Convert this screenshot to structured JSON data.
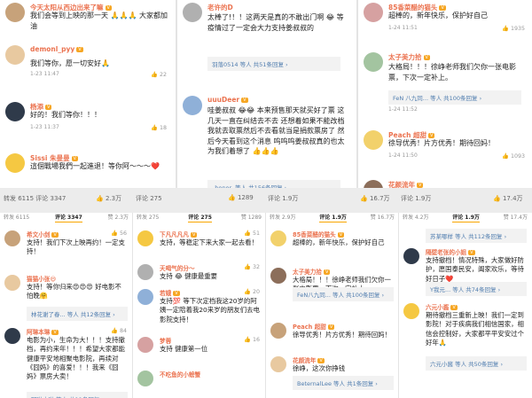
{
  "top": [
    [
      {
        "name": "今天太阳从西边出来了嘛",
        "lvl": "V",
        "text": "我们会等到上映的那一天 🙏🙏🙏 大家都加油",
        "meta": "",
        "like": ""
      },
      {
        "name": "demonl_pyy",
        "lvl": "V",
        "text": "我们等你，愿一切安好🙏",
        "meta": "1-23 11:47",
        "like": "👍 22"
      },
      {
        "name": "杨添",
        "lvl": "V",
        "text": "好的！我们等你！！！",
        "meta": "1-23 11:37",
        "like": "👍 18"
      },
      {
        "name": "Sissi 朱曼曼",
        "lvl": "V",
        "text": "這個戰場我們一起進退！等你阿～～～❤️",
        "meta": "",
        "like": ""
      }
    ],
    [
      {
        "name": "老许的D",
        "lvl": "",
        "text": "太棒了!！！这两天是真的不敢出门啊 😂 等疫情过了一定会大力支持姜叔叔的",
        "meta": "",
        "like": "",
        "reply": "羽落0514 等人  共51条回复 ›"
      },
      {
        "name": "uuuDeer",
        "lvl": "V",
        "text": "哇姜叔叔 😂😂 本来预售那天就买好了票 这几天一直在纠结去不去 还想着如果不能改档我就去取票然后不去看就当是捐款票房了 然后今天看到这个消息 呜呜呜姜叔叔真的也太为我们着想了 👍👍👍",
        "meta": "1-23 11:52",
        "like": "👍 8859",
        "reply": "_honor- 等人  共156条回复 ›"
      }
    ],
    [
      {
        "name": "85香菜醋的猫头",
        "lvl": "V",
        "text": "超棒的，新年快乐，保护好自己",
        "meta": "1-24 11:51",
        "like": "👍 1935"
      },
      {
        "name": "太子美力拾",
        "lvl": "V",
        "text": "大格局！！！徐峥老师我们欠你一张电影票，下次一定补上。",
        "meta": "1-24 11:52",
        "like": "",
        "reply": "FeN 八九同... 等人  共100条回复 ›"
      },
      {
        "name": "Peach 超甜",
        "lvl": "V",
        "text": "徐导优秀！片方优秀！期待回妈！",
        "meta": "1-24 11:50",
        "like": "👍 1093"
      },
      {
        "name": "花颜流年",
        "lvl": "V",
        "text": "徐峥……送你 掉泪",
        "meta": "",
        "like": ""
      }
    ]
  ],
  "labels": [
    {
      "text": "转发 6115 评论 3347",
      "right": "👍 2.3万"
    },
    {
      "text": "评论 275",
      "right": "👍 1289"
    },
    {
      "text": "评论 1.9万",
      "right": "👍 16.7万"
    },
    {
      "text": "评论 1.9万",
      "right": "👍 17.4万"
    }
  ],
  "bot": [
    {
      "tabs": [
        "转发 6115",
        "评论 3347",
        "赞 2.3万"
      ],
      "items": [
        {
          "name": "希文小剑",
          "lvl": "V",
          "text": "支持！我们下次上映再约！一定支持！",
          "meta": "",
          "like": "👍 56"
        },
        {
          "name": "猫猫小张😄",
          "lvl": "",
          "text": "支持！等你归来😍😍😍 好电影不怕晚🤗",
          "meta": "",
          "like": ""
        },
        {
          "name": "",
          "lvl": "",
          "text": "",
          "meta": "",
          "like": "",
          "reply": "林花谢了春... 等人  共12条回复 ›"
        },
        {
          "name": "阿琳本琳",
          "lvl": "V",
          "text": "电影为小，生命为大！！！支持撤档，再约来年！！！希望大家都能健康平安地相聚电影院，再续对《囧妈》的喜爱！！！我来《囧妈》票房大卖！",
          "meta": "",
          "like": "👍 84"
        },
        {
          "name": "",
          "lvl": "",
          "text": "",
          "meta": "",
          "like": "",
          "reply": "阿琳本琳 等人  共11条回复 ›"
        }
      ]
    },
    {
      "tabs": [
        "转发 275",
        "评论 275",
        "赞 1289"
      ],
      "items": [
        {
          "name": "下凡凡凡凡",
          "lvl": "V",
          "text": "支持，等稳定下来大家一起去看！",
          "meta": "",
          "like": "👍 51"
        },
        {
          "name": "天喝气的分～",
          "lvl": "",
          "text": "支持 😂 健康最重要",
          "meta": "",
          "like": "👍 32"
        },
        {
          "name": "若娥",
          "lvl": "V",
          "text": "支持💯 等下次定档我这20岁的阿姨一定陪着我20来岁的朋友们去电影院支持！",
          "meta": "",
          "like": "👍 20"
        },
        {
          "name": "梦蓉",
          "lvl": "",
          "text": "支持 健康第一位",
          "meta": "",
          "like": "👍 16"
        },
        {
          "name": "不吃鱼的小螃蟹",
          "lvl": "",
          "text": "",
          "meta": "",
          "like": ""
        }
      ]
    },
    {
      "tabs": [
        "转发 2.9万",
        "评论 1.9万",
        "赞 16.7万"
      ],
      "items": [
        {
          "name": "85香菜醋的猫头",
          "lvl": "V",
          "text": "超棒的，新年快乐，保护好自己",
          "meta": "",
          "like": ""
        },
        {
          "name": "太子美力拾",
          "lvl": "V",
          "text": "大格局！！！徐峥老师我们欠你一张电影票，下次一定补上",
          "meta": "",
          "like": "",
          "reply": "FeN八九同... 等人 共100条回复 ›"
        },
        {
          "name": "Peach 超甜",
          "lvl": "V",
          "text": "徐导优秀！片方优秀！期待回妈！",
          "meta": "",
          "like": ""
        },
        {
          "name": "花颜流年",
          "lvl": "V",
          "text": "徐峥，这次你挣钱",
          "meta": "",
          "like": "",
          "reply": "BeternalLee 等人 共1条回复 ›"
        }
      ]
    },
    {
      "tabs": [
        "转发 4.2万",
        "评论 1.9万",
        "赞 17.4万"
      ],
      "items": [
        {
          "name": "",
          "lvl": "",
          "text": "",
          "meta": "",
          "like": "",
          "reply": "苏某哪样 等人  共112条回复 ›"
        },
        {
          "name": "隔壁老张的小姐",
          "lvl": "V",
          "text": "支持撤档！情况特殊，大家做好防护，愿国泰民安，阖家欢乐，等待好日子❤️",
          "meta": "",
          "like": ""
        },
        {
          "name": "",
          "lvl": "",
          "text": "",
          "meta": "",
          "like": "",
          "reply": "Y我元... 等人  共74条回复 ›"
        },
        {
          "name": "六元小酱",
          "lvl": "V",
          "text": "期待撤档三重新上映！我们一定到影院！对于疾病我们相信国家，相信会控制好，大家都平平安安过个好年🙏",
          "meta": "",
          "like": ""
        },
        {
          "name": "",
          "lvl": "",
          "text": "",
          "meta": "",
          "like": "",
          "reply": "六元小酱 等人  共50条回复 ›"
        }
      ]
    }
  ]
}
